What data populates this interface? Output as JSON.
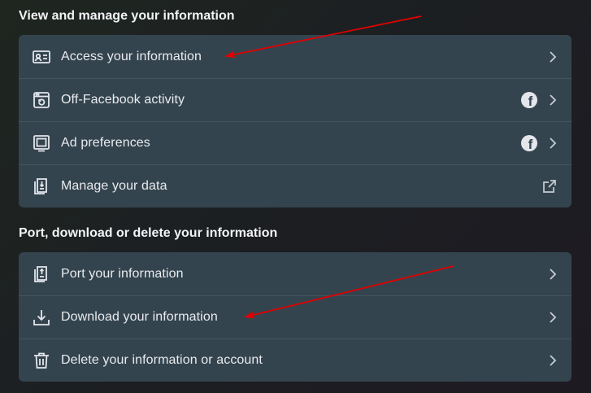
{
  "sections": [
    {
      "title": "View and manage your information",
      "items": [
        {
          "label": "Access your information",
          "icon": "id-card-icon",
          "badge": null,
          "trailing": "chevron-right-icon"
        },
        {
          "label": "Off-Facebook activity",
          "icon": "browser-history-icon",
          "badge": "facebook-icon",
          "trailing": "chevron-right-icon"
        },
        {
          "label": "Ad preferences",
          "icon": "monitor-icon",
          "badge": "facebook-icon",
          "trailing": "chevron-right-icon"
        },
        {
          "label": "Manage your data",
          "icon": "document-stack-icon",
          "badge": null,
          "trailing": "external-link-icon"
        }
      ]
    },
    {
      "title": "Port, download or delete your information",
      "items": [
        {
          "label": "Port your information",
          "icon": "document-stack-icon",
          "badge": null,
          "trailing": "chevron-right-icon"
        },
        {
          "label": "Download your information",
          "icon": "download-icon",
          "badge": null,
          "trailing": "chevron-right-icon"
        },
        {
          "label": "Delete your information or account",
          "icon": "trash-icon",
          "badge": null,
          "trailing": "chevron-right-icon"
        }
      ]
    }
  ],
  "facebook_badge_glyph": "f",
  "colors": {
    "card": "#34444f",
    "divider": "#45555f",
    "text": "#e9ebee",
    "annotation_arrow": "#e00000"
  }
}
